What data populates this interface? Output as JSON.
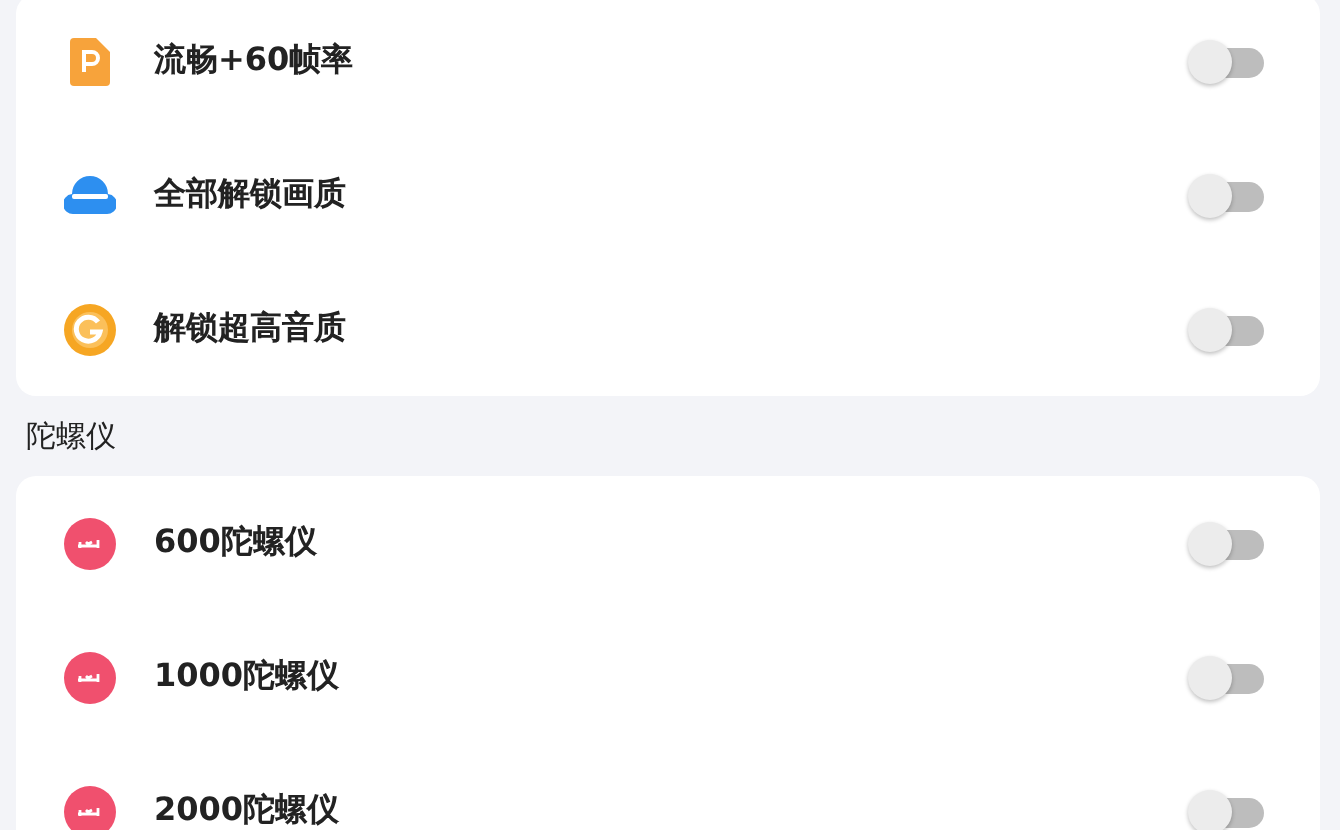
{
  "sections": [
    {
      "items": [
        {
          "label": "流畅+60帧率",
          "kind": "document",
          "on": false
        },
        {
          "label": "全部解锁画质",
          "kind": "cloud",
          "on": false
        },
        {
          "label": "解锁超高音质",
          "kind": "coin",
          "on": false
        }
      ]
    },
    {
      "title": "陀螺仪",
      "items": [
        {
          "label": "600陀螺仪",
          "kind": "gyro",
          "on": false
        },
        {
          "label": "1000陀螺仪",
          "kind": "gyro",
          "on": false
        },
        {
          "label": "2000陀螺仪",
          "kind": "gyro",
          "on": false
        }
      ]
    }
  ]
}
